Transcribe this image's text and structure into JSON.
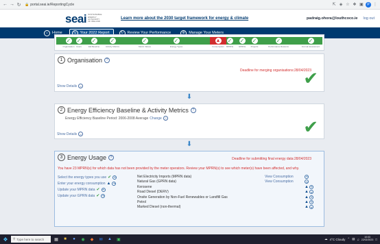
{
  "browser": {
    "url": "portal.seai.ie/ReportingCycle",
    "nav_icons": [
      "back-arrow",
      "forward-arrow",
      "reload"
    ],
    "toolbar_icons": [
      "share",
      "translate",
      "bookmark-star",
      "extensions",
      "profile"
    ]
  },
  "header": {
    "logo_text": "seai",
    "logo_tagline": "SUSTAINABLE ENERGY AUTHORITY OF IRELAND",
    "promo_link": "Learn more about the 2030 target framework for energy & climate",
    "user_email": "padraig.ohora@louthcoco.ie",
    "logout_label": "log out"
  },
  "nav": {
    "items": [
      {
        "label": "Home",
        "icon": "home-icon"
      },
      {
        "label": "Your 2022 Report",
        "icon": "arrows-icon",
        "active": true
      },
      {
        "label": "Review Your Performance",
        "icon": "refresh-icon"
      },
      {
        "label": "Manage Your Meters",
        "icon": "gears-icon"
      }
    ]
  },
  "progress": {
    "steps": [
      {
        "label": "Organisation",
        "status": "done"
      },
      {
        "label": "Users",
        "status": "done"
      },
      {
        "label": "EE Baseline",
        "status": "done"
      },
      {
        "label": "Activity Metrics",
        "status": "done"
      },
      {
        "label": "Metric Values",
        "status": "done"
      },
      {
        "label": "Energy Types",
        "status": "done"
      },
      {
        "label": "Consumption",
        "status": "warning"
      },
      {
        "label": "MPRNs",
        "status": "done"
      },
      {
        "label": "GPRNs",
        "status": "done"
      },
      {
        "label": "Projects",
        "status": "done"
      },
      {
        "label": "Performance Reasons",
        "status": "done"
      },
      {
        "label": "Formal Assessment",
        "status": "done"
      }
    ]
  },
  "sections": {
    "organisation": {
      "number": "1",
      "title": "Organisation",
      "deadline": "Deadline for merging organisations:28/04/2023",
      "show_details": "Show Details"
    },
    "baseline": {
      "number": "2",
      "title": "Energy Efficiency Baseline & Activity Metrics",
      "period_text": "Energy Efficiency Baseline Period: 2006-2008 Average",
      "change_label": "Change",
      "show_details": "Show Details"
    },
    "energy_usage": {
      "number": "3",
      "title": "Energy Usage",
      "deadline": "Deadline for submitting final energy data:28/04/2023",
      "warning": "You have 23 MPRN(s) for which data has not been provided by the meter operators. Review your MPRN(s) to see which meter(s) have been affected, and why.",
      "actions": [
        {
          "label": "Select the energy types you use",
          "status": "done"
        },
        {
          "label": "Enter your energy consumption",
          "status": "warning"
        },
        {
          "label": "Update your MPRN data",
          "status": "done"
        },
        {
          "label": "Update your GPRN data",
          "status": "done"
        }
      ],
      "meters": [
        {
          "name": "Net Electricity Imports (MPRN data)",
          "view": "View Consumption",
          "warning": false
        },
        {
          "name": "Natural Gas (GPRN data)",
          "view": "View Consumption",
          "warning": false
        },
        {
          "name": "Kerosene",
          "view": "",
          "warning": true
        },
        {
          "name": "Road Diesel (DERV)",
          "view": "",
          "warning": true
        },
        {
          "name": "Onsite Generation by Non-Fuel Renewables or Landfill Gas",
          "view": "",
          "warning": true
        },
        {
          "name": "Petrol",
          "view": "",
          "warning": true
        },
        {
          "name": "Marked Diesel (non-thermal)",
          "view": "",
          "warning": true
        }
      ]
    }
  },
  "taskbar": {
    "search_placeholder": "Type here to search",
    "weather": "4°C Cloudy",
    "time": "10:03",
    "date": "22/02/2023"
  },
  "colors": {
    "brand_navy": "#003a70",
    "brand_green": "#3bb04a",
    "progress_green": "#3f9f4a",
    "warning_red": "#d22d2d",
    "link_blue": "#4a6fa5"
  }
}
